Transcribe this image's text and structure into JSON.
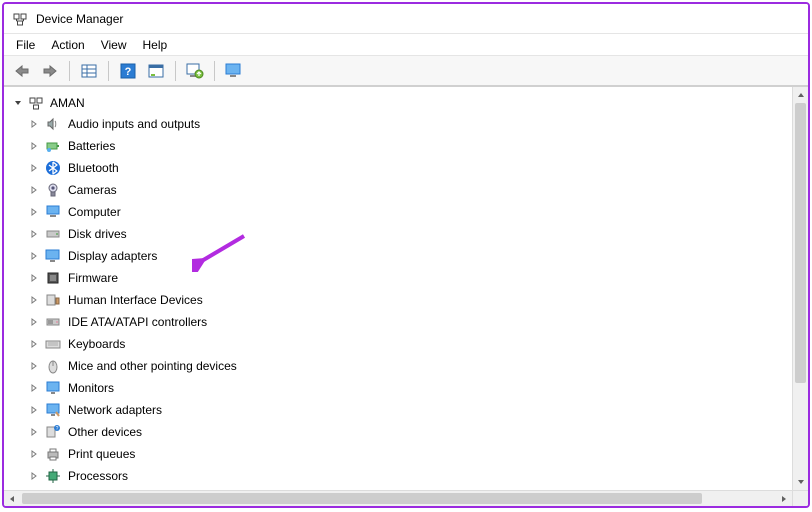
{
  "window": {
    "title": "Device Manager"
  },
  "menu": {
    "file": "File",
    "action": "Action",
    "view": "View",
    "help": "Help"
  },
  "toolbar": {
    "back": "back-arrow",
    "forward": "forward-arrow",
    "show_hidden": "show-hidden",
    "help": "help",
    "properties": "properties",
    "scan": "scan-hardware",
    "monitor": "monitor"
  },
  "tree": {
    "root": {
      "expanded": true,
      "label": "AMAN"
    },
    "items": [
      {
        "label": "Audio inputs and outputs",
        "icon": "speaker"
      },
      {
        "label": "Batteries",
        "icon": "battery"
      },
      {
        "label": "Bluetooth",
        "icon": "bluetooth"
      },
      {
        "label": "Cameras",
        "icon": "camera"
      },
      {
        "label": "Computer",
        "icon": "computer"
      },
      {
        "label": "Disk drives",
        "icon": "disk"
      },
      {
        "label": "Display adapters",
        "icon": "display"
      },
      {
        "label": "Firmware",
        "icon": "firmware"
      },
      {
        "label": "Human Interface Devices",
        "icon": "hid"
      },
      {
        "label": "IDE ATA/ATAPI controllers",
        "icon": "ide"
      },
      {
        "label": "Keyboards",
        "icon": "keyboard"
      },
      {
        "label": "Mice and other pointing devices",
        "icon": "mouse"
      },
      {
        "label": "Monitors",
        "icon": "monitor"
      },
      {
        "label": "Network adapters",
        "icon": "network"
      },
      {
        "label": "Other devices",
        "icon": "other"
      },
      {
        "label": "Print queues",
        "icon": "printer"
      },
      {
        "label": "Processors",
        "icon": "cpu"
      }
    ]
  },
  "annotation": {
    "target": "Display adapters",
    "color": "#b22be0"
  }
}
